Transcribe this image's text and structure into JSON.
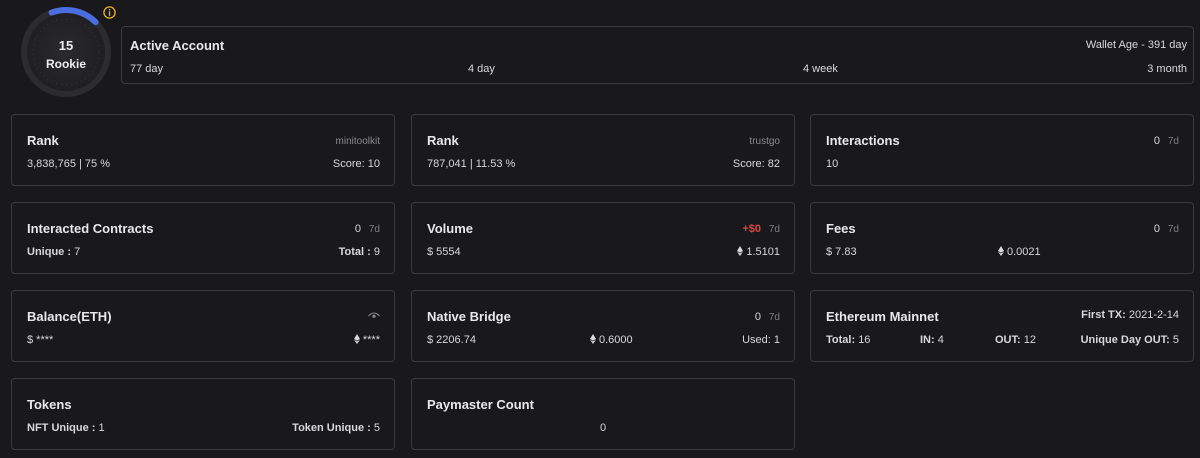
{
  "level": {
    "value": "15",
    "rank_name": "Rookie",
    "progress": 0.18,
    "ring_color": "#4a6ee0",
    "info_icon": "info-icon",
    "info_color": "#e8b324"
  },
  "active_account": {
    "title": "Active Account",
    "wallet_age": "Wallet Age - 391 day",
    "periods": [
      "77 day",
      "4 day",
      "4 week",
      "3 month"
    ]
  },
  "rank_minitoolkit": {
    "title": "Rank",
    "source": "minitoolkit",
    "value": "3,838,765 | 75 %",
    "score": "Score: 10"
  },
  "rank_trustgo": {
    "title": "Rank",
    "source": "trustgo",
    "value": "787,041 | 11.53 %",
    "score": "Score: 82"
  },
  "interactions": {
    "title": "Interactions",
    "delta": "0",
    "period": "7d",
    "value": "10"
  },
  "contracts": {
    "title": "Interacted Contracts",
    "delta": "0",
    "period": "7d",
    "unique_label": "Unique :",
    "unique": "7",
    "total_label": "Total :",
    "total": "9"
  },
  "volume": {
    "title": "Volume",
    "delta": "+$0",
    "period": "7d",
    "usd": "$ 5554",
    "eth": "1.5101"
  },
  "fees": {
    "title": "Fees",
    "delta": "0",
    "period": "7d",
    "usd": "$ 7.83",
    "eth": "0.0021"
  },
  "balance": {
    "title": "Balance(ETH)",
    "icon": "eye-icon",
    "usd": "$ ****",
    "eth": "****"
  },
  "bridge": {
    "title": "Native Bridge",
    "delta": "0",
    "period": "7d",
    "usd": "$ 2206.74",
    "eth": "0.6000",
    "used_label": "Used:",
    "used": "1"
  },
  "mainnet": {
    "title": "Ethereum Mainnet",
    "first_tx_label": "First TX:",
    "first_tx": "2021-2-14",
    "total_label": "Total:",
    "total": "16",
    "in_label": "IN:",
    "in": "4",
    "out_label": "OUT:",
    "out": "12",
    "unique_out_label": "Unique Day OUT:",
    "unique_out": "5"
  },
  "tokens": {
    "title": "Tokens",
    "nft_label": "NFT Unique :",
    "nft": "1",
    "token_label": "Token Unique :",
    "token": "5"
  },
  "paymaster": {
    "title": "Paymaster Count",
    "value": "0"
  }
}
